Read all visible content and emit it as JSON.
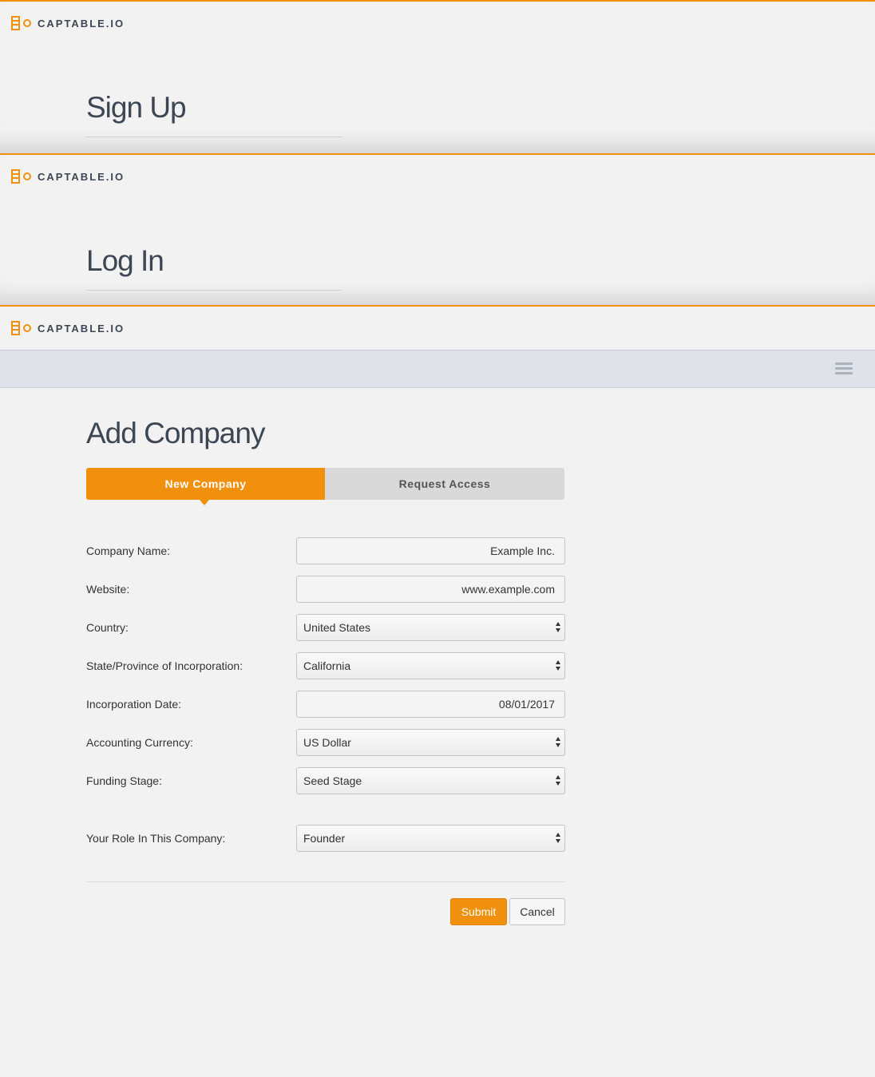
{
  "brand": {
    "name": "CAPTABLE.IO"
  },
  "signup_panel": {
    "title": "Sign Up"
  },
  "login_panel": {
    "title": "Log In"
  },
  "main": {
    "title": "Add Company",
    "tabs": [
      {
        "label": "New Company",
        "active": true
      },
      {
        "label": "Request Access",
        "active": false
      }
    ],
    "form": {
      "company_name": {
        "label": "Company Name:",
        "value": "Example Inc."
      },
      "website": {
        "label": "Website:",
        "value": "www.example.com"
      },
      "country": {
        "label": "Country:",
        "value": "United States"
      },
      "state": {
        "label": "State/Province of Incorporation:",
        "value": "California"
      },
      "incorporation_date": {
        "label": "Incorporation Date:",
        "value": "08/01/2017"
      },
      "currency": {
        "label": "Accounting Currency:",
        "value": "US Dollar"
      },
      "funding_stage": {
        "label": "Funding Stage:",
        "value": "Seed Stage"
      },
      "role": {
        "label": "Your Role In This Company:",
        "value": "Founder"
      }
    },
    "actions": {
      "submit": "Submit",
      "cancel": "Cancel"
    }
  },
  "colors": {
    "accent": "#f0900c",
    "heading": "#3d4653",
    "toolbar_bg": "#dfe3e9",
    "page_bg": "#f2f2f2"
  },
  "icons": {
    "menu": "hamburger-menu-icon",
    "logo": "captable-logo-icon"
  }
}
